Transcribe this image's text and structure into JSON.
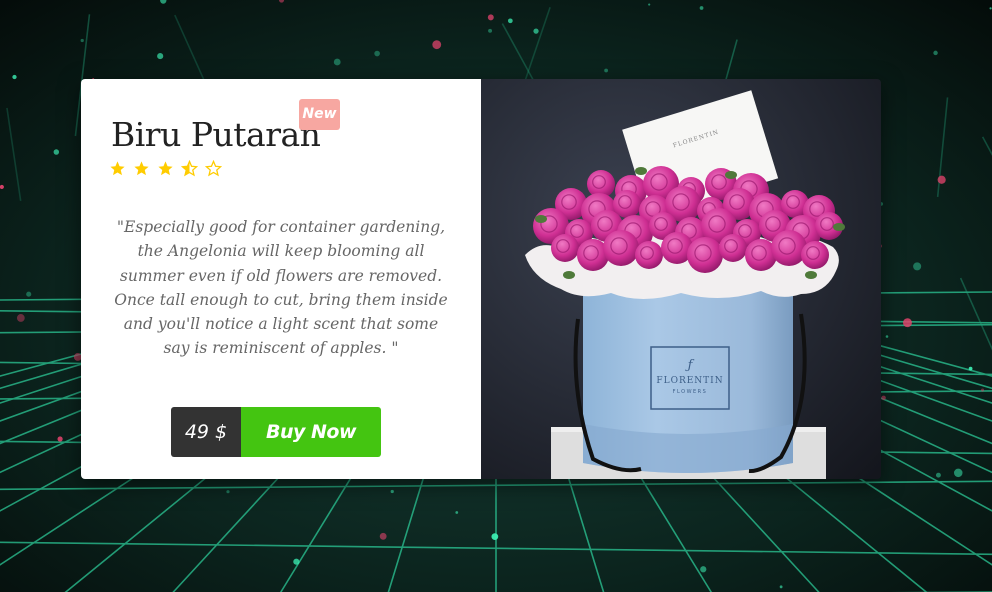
{
  "product": {
    "title": "Biru Putaran",
    "badge": "New",
    "rating": 3.5,
    "rating_max": 5,
    "description": "\"Especially good for container gardening, the Angelonia will keep blooming all summer even if old flowers are removed. Once tall enough to cut, bring them inside and you'll notice a light scent that some say is reminiscent of apples. \"",
    "price": "49 $",
    "buy_label": "Buy Now",
    "image": {
      "brand": "FLORENTIN",
      "brand_sub": "FLOWERS",
      "card_text": "FLORENTIN"
    }
  },
  "colors": {
    "accent": "#44c511",
    "badge": "#f7a7a1",
    "star": "#ffcc00",
    "price_bg": "#333333"
  },
  "icons": {
    "star_full": "star-icon",
    "star_half": "star-half-icon",
    "star_empty": "star-outline-icon"
  }
}
